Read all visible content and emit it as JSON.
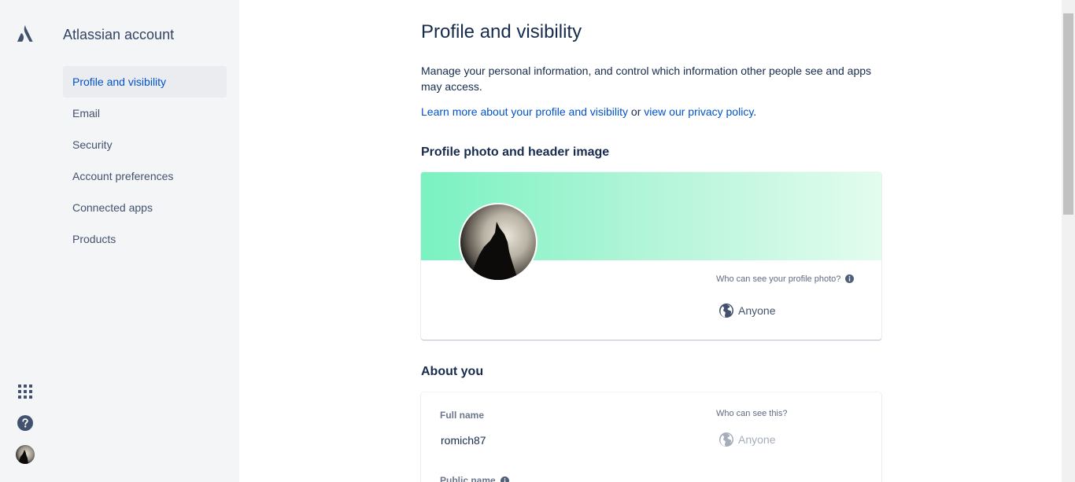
{
  "rail": {
    "logo_icon": "atlassian-logo-icon",
    "apps_icon": "app-switcher-icon",
    "help_icon": "help-icon"
  },
  "sidebar": {
    "title": "Atlassian account",
    "items": [
      {
        "label": "Profile and visibility",
        "active": true
      },
      {
        "label": "Email"
      },
      {
        "label": "Security"
      },
      {
        "label": "Account preferences"
      },
      {
        "label": "Connected apps"
      },
      {
        "label": "Products"
      }
    ]
  },
  "main": {
    "title": "Profile and visibility",
    "description": "Manage your personal information, and control which information other people see and apps may access.",
    "learn_link": "Learn more about your profile and visibility",
    "or_text": " or ",
    "privacy_link": "view our privacy policy",
    "period": "."
  },
  "photo_section": {
    "heading": "Profile photo and header image",
    "who_label": "Who can see your profile photo?",
    "visibility": "Anyone"
  },
  "about_section": {
    "heading": "About you",
    "full_name_label": "Full name",
    "full_name_value": "romich87",
    "who_label": "Who can see this?",
    "visibility": "Anyone",
    "public_name_label": "Public name"
  },
  "colors": {
    "accent": "#0052CC",
    "sidebar_bg": "#F4F5F7",
    "header_gradient_start": "#79F2C0",
    "header_gradient_end": "#E3FCEF"
  }
}
